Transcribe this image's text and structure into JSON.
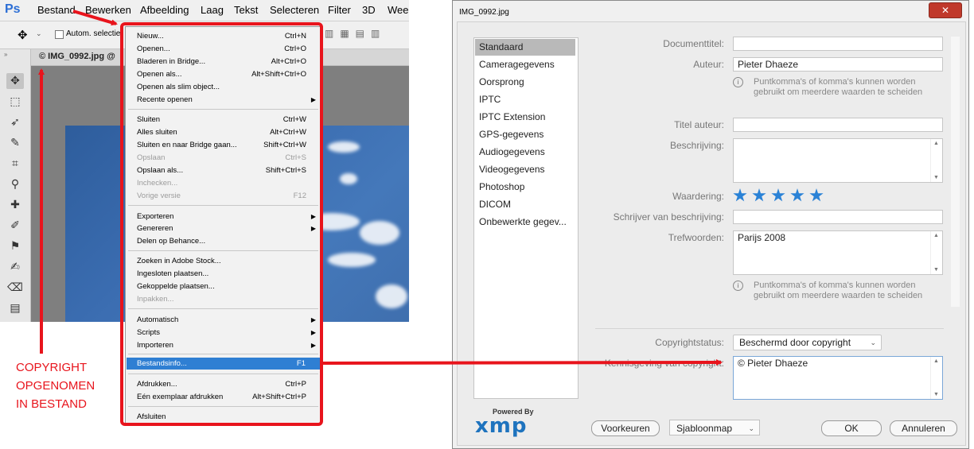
{
  "photoshop": {
    "logo": "Ps",
    "menubar": [
      "Bestand",
      "Bewerken",
      "Afbeelding",
      "Laag",
      "Tekst",
      "Selecteren",
      "Filter",
      "3D",
      "Weer"
    ],
    "options_bar": {
      "auto_select_label": "Autom. selectie"
    },
    "document_tab": "© IMG_0992.jpg @",
    "tools": [
      "move-tool",
      "marquee-tool",
      "lasso-tool",
      "quick-selection-tool",
      "crop-tool",
      "eyedropper-tool",
      "healing-brush-tool",
      "brush-tool",
      "clone-stamp-tool",
      "history-brush-tool",
      "eraser-tool",
      "gradient-tool"
    ]
  },
  "file_menu": {
    "items": [
      {
        "label": "Nieuw...",
        "shortcut": "Ctrl+N"
      },
      {
        "label": "Openen...",
        "shortcut": "Ctrl+O"
      },
      {
        "label": "Bladeren in Bridge...",
        "shortcut": "Alt+Ctrl+O"
      },
      {
        "label": "Openen als...",
        "shortcut": "Alt+Shift+Ctrl+O"
      },
      {
        "label": "Openen als slim object..."
      },
      {
        "label": "Recente openen",
        "submenu": true
      },
      {
        "label": "Sluiten",
        "shortcut": "Ctrl+W"
      },
      {
        "label": "Alles sluiten",
        "shortcut": "Alt+Ctrl+W"
      },
      {
        "label": "Sluiten en naar Bridge gaan...",
        "shortcut": "Shift+Ctrl+W"
      },
      {
        "label": "Opslaan",
        "shortcut": "Ctrl+S",
        "disabled": true
      },
      {
        "label": "Opslaan als...",
        "shortcut": "Shift+Ctrl+S"
      },
      {
        "label": "Inchecken...",
        "disabled": true
      },
      {
        "label": "Vorige versie",
        "shortcut": "F12",
        "disabled": true
      },
      {
        "label": "Exporteren",
        "submenu": true
      },
      {
        "label": "Genereren",
        "submenu": true
      },
      {
        "label": "Delen op Behance..."
      },
      {
        "label": "Zoeken in Adobe Stock..."
      },
      {
        "label": "Ingesloten plaatsen..."
      },
      {
        "label": "Gekoppelde plaatsen..."
      },
      {
        "label": "Inpakken...",
        "disabled": true
      },
      {
        "label": "Automatisch",
        "submenu": true
      },
      {
        "label": "Scripts",
        "submenu": true
      },
      {
        "label": "Importeren",
        "submenu": true
      },
      {
        "label": "Bestandsinfo...",
        "shortcut": "F1",
        "highlighted": true
      },
      {
        "label": "Afdrukken...",
        "shortcut": "Ctrl+P"
      },
      {
        "label": "Eén exemplaar afdrukken",
        "shortcut": "Alt+Shift+Ctrl+P"
      },
      {
        "label": "Afsluiten"
      }
    ]
  },
  "annotation": {
    "lines": [
      "COPYRIGHT",
      "OPGENOMEN",
      "IN BESTAND"
    ],
    "color": "#e8141c"
  },
  "file_info_dialog": {
    "title": "IMG_0992.jpg",
    "categories": [
      "Standaard",
      "Cameragegevens",
      "Oorsprong",
      "IPTC",
      "IPTC Extension",
      "GPS-gegevens",
      "Audiogegevens",
      "Videogegevens",
      "Photoshop",
      "DICOM",
      "Onbewerkte gegev..."
    ],
    "selected_category": "Standaard",
    "fields": {
      "document_title": {
        "label": "Documenttitel:",
        "value": ""
      },
      "author": {
        "label": "Auteur:",
        "value": "Pieter Dhaeze"
      },
      "author_hint": "Puntkomma's of komma's kunnen worden gebruikt om meerdere waarden te scheiden",
      "author_title": {
        "label": "Titel auteur:",
        "value": ""
      },
      "description": {
        "label": "Beschrijving:",
        "value": ""
      },
      "rating": {
        "label": "Waardering:",
        "value": 5,
        "max": 5
      },
      "description_writer": {
        "label": "Schrijver van beschrijving:",
        "value": ""
      },
      "keywords": {
        "label": "Trefwoorden:",
        "value": "Parijs 2008"
      },
      "keywords_hint": "Puntkomma's of komma's kunnen worden gebruikt om meerdere waarden te scheiden",
      "copyright_status": {
        "label": "Copyrightstatus:",
        "value": "Beschermd door copyright"
      },
      "copyright_notice": {
        "label": "Kennisgeving van copyright:",
        "value": "© Pieter Dhaeze"
      }
    },
    "logo": {
      "small": "Powered By",
      "big": "xmp"
    },
    "buttons": {
      "preferences": "Voorkeuren",
      "template_folder": "Sjabloonmap",
      "ok": "OK",
      "cancel": "Annuleren"
    },
    "accent_color": "#2a82d6"
  }
}
